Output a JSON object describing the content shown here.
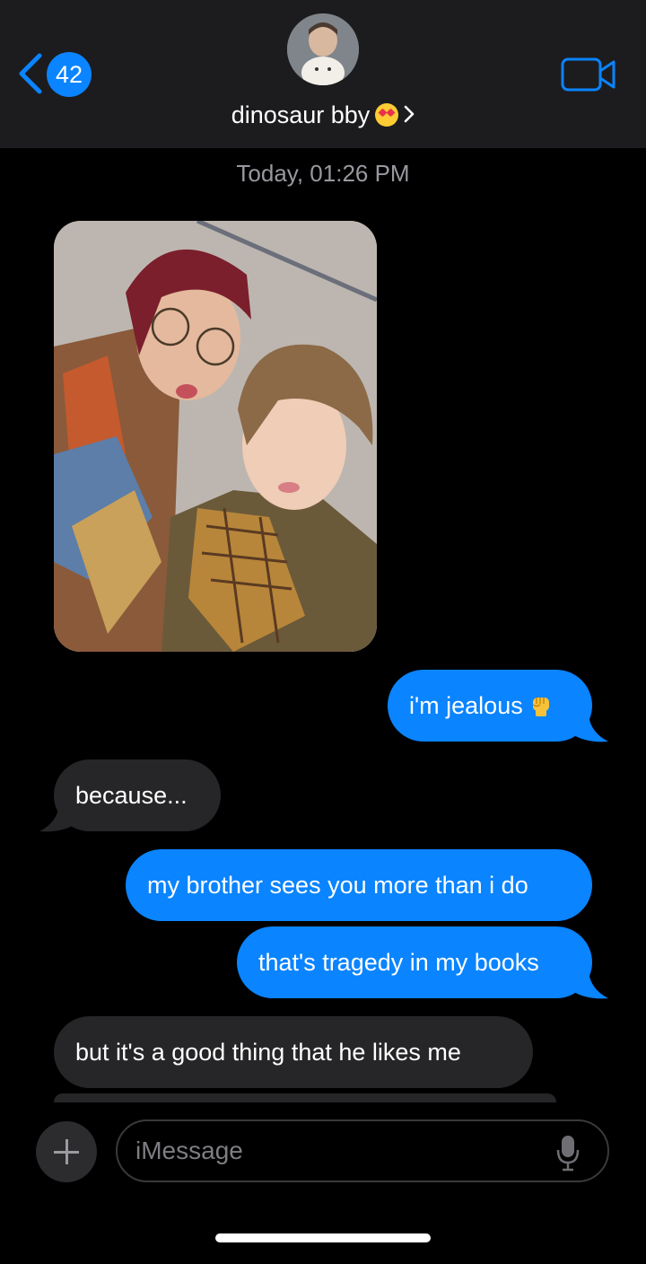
{
  "header": {
    "back_badge": "42",
    "contact_name": "dinosaur bby",
    "contact_emoji": "heart-eyes-emoji"
  },
  "thread": {
    "timestamp": "Today, 01:26 PM",
    "messages": [
      {
        "from": "me",
        "text": "i'm jealous",
        "emoji": "raised-fist-emoji"
      },
      {
        "from": "them",
        "text": "because..."
      },
      {
        "from": "me",
        "text": "my brother sees you more than i do"
      },
      {
        "from": "me",
        "text": "that's tragedy in my books"
      },
      {
        "from": "them",
        "text": "but it's a good thing that he likes me"
      }
    ]
  },
  "composer": {
    "placeholder": "iMessage"
  },
  "colors": {
    "sent_bubble": "#0a84ff",
    "received_bubble": "#262628",
    "header_bg": "#1c1c1e"
  }
}
